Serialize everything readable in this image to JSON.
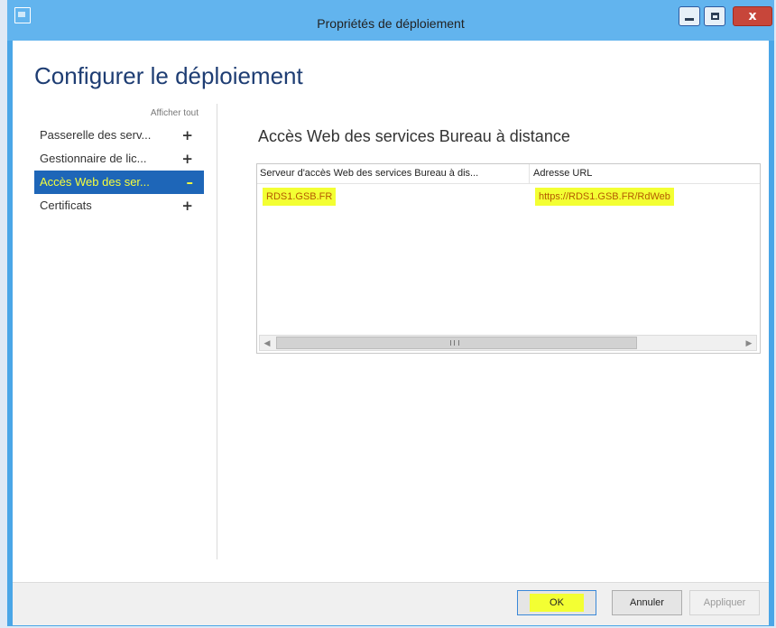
{
  "window": {
    "title": "Propriétés de déploiement"
  },
  "page": {
    "heading": "Configurer le déploiement"
  },
  "nav": {
    "show_all": "Afficher tout",
    "items": [
      {
        "label": "Passerelle des serv...",
        "expander": "+"
      },
      {
        "label": "Gestionnaire de lic...",
        "expander": "+"
      },
      {
        "label": "Accès Web des ser...",
        "expander": "–",
        "selected": true
      },
      {
        "label": "Certificats",
        "expander": "+"
      }
    ]
  },
  "section": {
    "title": "Accès Web des services Bureau à distance",
    "columns": [
      "Serveur d'accès Web des services Bureau à dis...",
      "Adresse URL"
    ],
    "rows": [
      {
        "server": "RDS1.GSB.FR",
        "url": "https://RDS1.GSB.FR/RdWeb"
      }
    ],
    "scroll_grip": "III"
  },
  "footer": {
    "ok": "OK",
    "cancel": "Annuler",
    "apply": "Appliquer"
  },
  "icons": {
    "app": "window-app-icon",
    "minimize": "minimize-icon",
    "maximize": "maximize-icon",
    "close": "close-icon",
    "close_glyph": "x"
  },
  "colors": {
    "titlebar": "#62b4ee",
    "selected_nav": "#1e66b8",
    "highlight": "#f3ff33",
    "close_button": "#c7463a"
  }
}
